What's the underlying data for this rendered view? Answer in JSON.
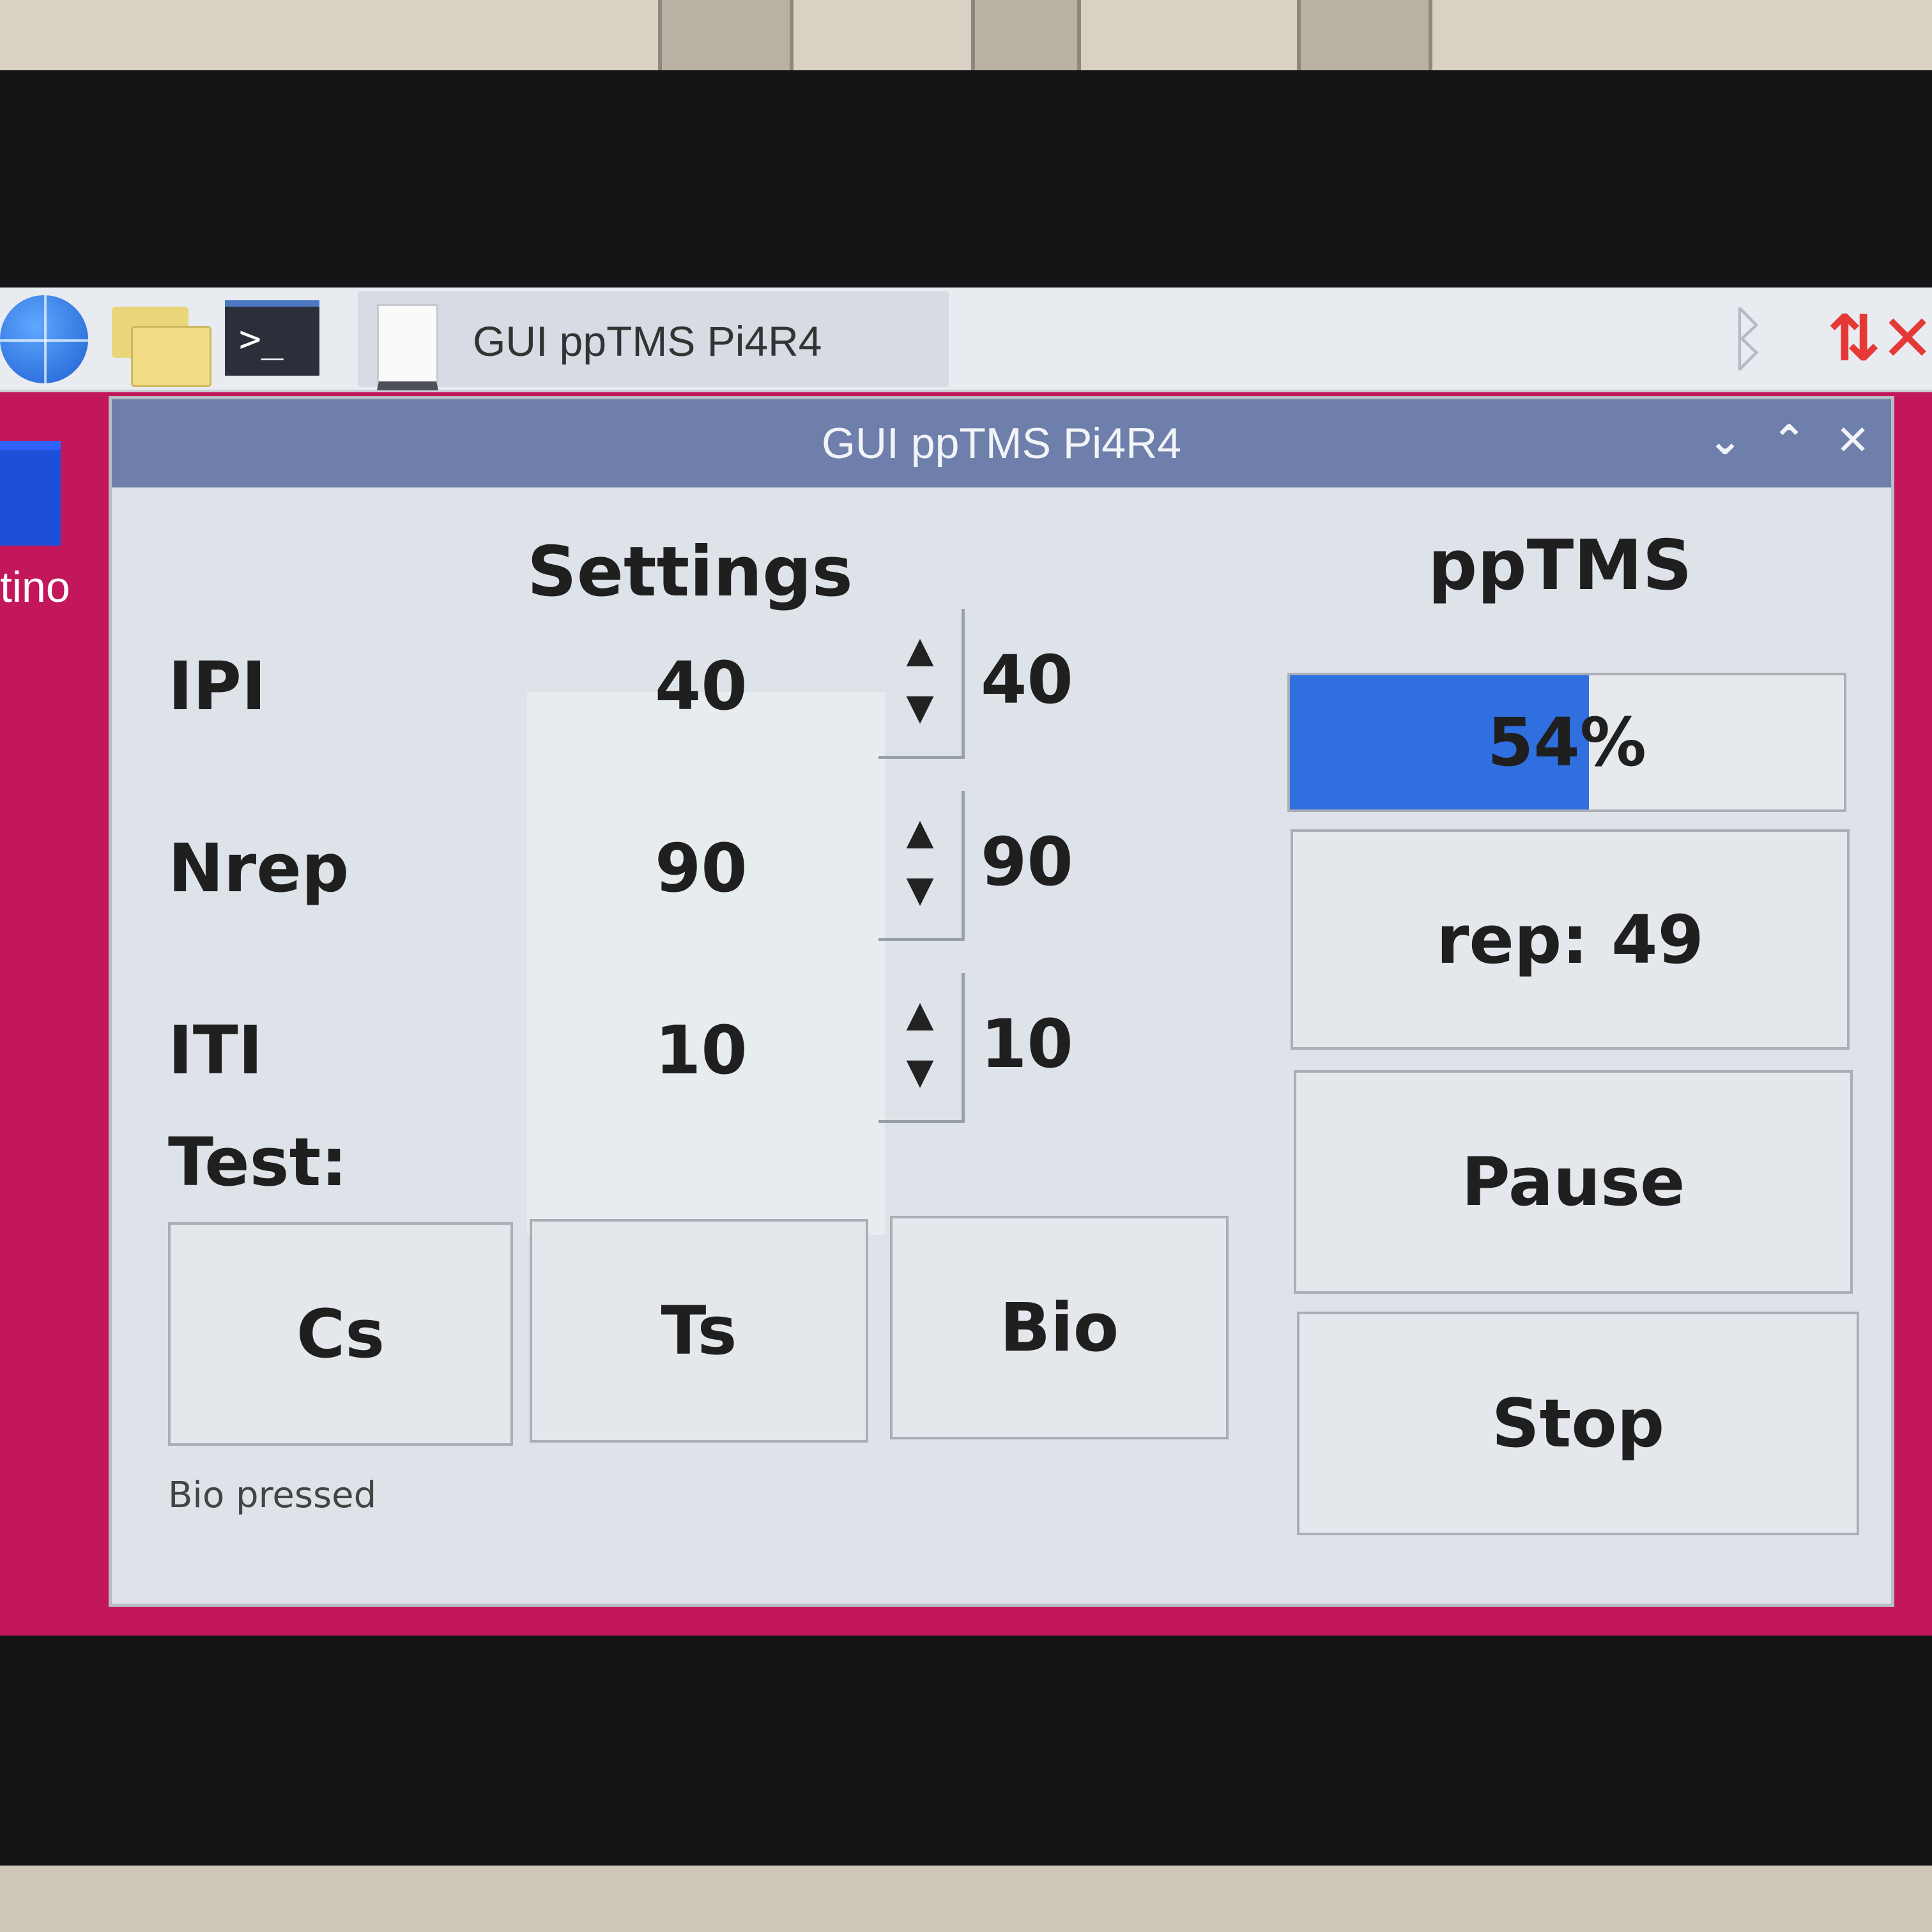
{
  "taskbar": {
    "task_label": "GUI ppTMS Pi4R4",
    "terminal_glyph": ">_",
    "bluetooth_glyph": "ᛒ",
    "network_glyph": "⇅✕"
  },
  "desktop": {
    "icon_label": "tino"
  },
  "window": {
    "title": "GUI ppTMS Pi4R4",
    "minimize_glyph": "⌄",
    "maximize_glyph": "⌃",
    "close_glyph": "✕"
  },
  "settings": {
    "heading": "Settings",
    "rows": [
      {
        "label": "IPI",
        "value": "40",
        "echo": "40"
      },
      {
        "label": "Nrep",
        "value": "90",
        "echo": "90"
      },
      {
        "label": "ITI",
        "value": "10",
        "echo": "10"
      }
    ],
    "up_glyph": "▲",
    "down_glyph": "▼"
  },
  "test": {
    "label": "Test:",
    "buttons": [
      "Cs",
      "Ts",
      "Bio"
    ]
  },
  "pptms": {
    "heading": "ppTMS",
    "progress_percent": 54,
    "progress_text": "54%",
    "rep_text": "rep: 49",
    "pause_label": "Pause",
    "stop_label": "Stop"
  },
  "status_text": "Bio pressed",
  "colors": {
    "desktop_background": "#c2185b",
    "titlebar": "#6e7fab",
    "progress_fill": "#2f6fe0"
  }
}
